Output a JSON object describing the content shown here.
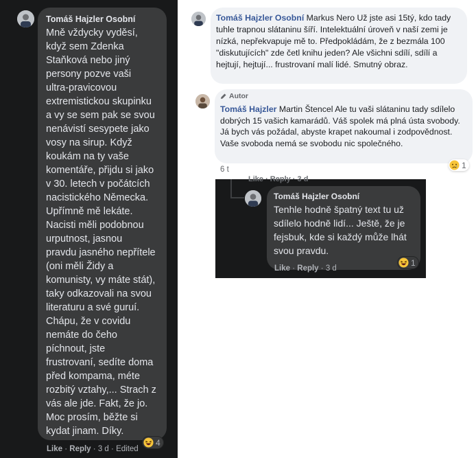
{
  "left_comment": {
    "author": "Tomáš Hajzler Osobní",
    "text": "Mně vždycky vyděsí,\nkdyž sem Zdenka\nStaňková nebo jiný\npersony pozve vaši\nultra-pravicovou\nextremistickou skupinku\na vy se sem pak se svou\nnenávistí sesypete jako\nvosy na sirup. Když\nkoukám na ty vaše\nkomentáře, přijdu si jako\nv 30. letech v počátcích\nnacistického Německa.\nUpřímně mě lekáte.\nNacisti měli podobnou\nurputnost, jasnou\npravdu jasného nepřítele\n(oni měli Židy a\nkomunisty, vy máte stát),\ntaky odkazovali na svou\nliteraturu a své guruí.\nChápu, že v covidu\nnemáte do čeho\npíchnout, jste\nfrustrovaní, sedíte doma\npřed kompama, méte\nrozbitý vztahy,... Strach z\nvás ale jde. Fakt, že jo.\nMoc prosím, běžte si\nkydat jinam. Díky.",
    "reaction_icon": "haha-emoji-icon",
    "reaction_count": "4",
    "like_label": "Like",
    "reply_label": "Reply",
    "time": "3 d",
    "edited_label": "Edited",
    "separator": "·"
  },
  "comment_1": {
    "author": "Tomáš Hajzler Osobní",
    "mention": "Markus Nero",
    "text": "Už jste asi 15tý, kdo tady tuhle trapnou slátaninu šíří. Intelektuální úroveň v naší zemi je nízká, nepřekvapuje mě to. Předpokládám, že z bezmála 100 \"diskutujících\" zde četl knihu jeden? Ale všichni sdílí, sdílí a hejtují, hejtují... frustrovaní malí lidé. Smutný obraz."
  },
  "comment_2": {
    "badge": "Autor",
    "badge_icon": "pen-icon",
    "author": "Tomáš Hajzler",
    "mention": "Martin Štencel",
    "text": "Ale tu vaši slátaninu tady sdílelo dobrých 15 vašich kamarádů. Váš spolek má plná ústa svobody. Já bych vás požádal, abyste krapet nakoumal i zodpovědnost. Vaše svoboda nemá se svobodu nic společného.",
    "time": "6 t",
    "reaction_icon": "sad-emoji-icon",
    "reaction_count": "1"
  },
  "inset_comment": {
    "ghost_actions": "Like · Reply · 3 d",
    "author": "Tomáš Hajzler Osobní",
    "text": "Tenhle hodně špatný text tu už sdílelo hodně lidí... Ještě, že je fejsbuk, kde si každý může lhát svou pravdu.",
    "reaction_icon": "haha-emoji-icon",
    "reaction_count": "1",
    "like_label": "Like",
    "reply_label": "Reply",
    "time": "3 d",
    "separator": "·"
  },
  "colors": {
    "dark_bg": "#18191a",
    "dark_bubble": "#3a3b3c",
    "light_bubble": "#f0f2f5",
    "name_link": "#385898"
  }
}
